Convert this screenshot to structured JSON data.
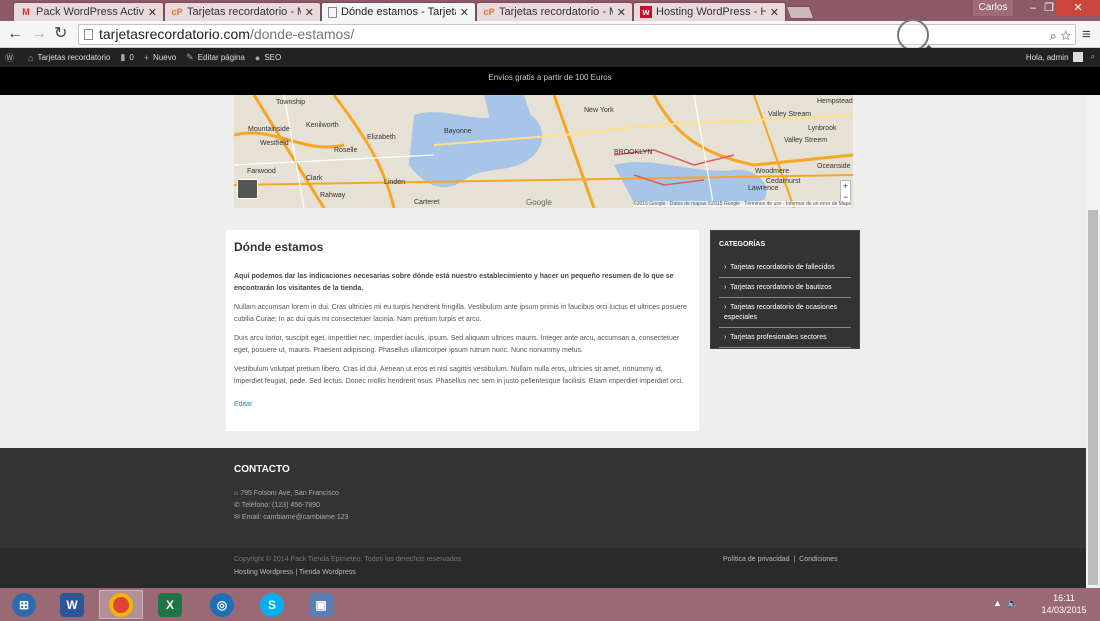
{
  "browser": {
    "tabs": [
      {
        "title": "Pack WordPress Activado",
        "icon": "gmail-icon"
      },
      {
        "title": "Tarjetas recordatorio - Mi",
        "icon": "cpanel-icon"
      },
      {
        "title": "Dónde estamos - Tarjetas",
        "icon": "page-icon",
        "active": true
      },
      {
        "title": "Tarjetas recordatorio - Mi",
        "icon": "cpanel-icon"
      },
      {
        "title": "Hosting WordPress - Host",
        "icon": "hosting-icon"
      }
    ],
    "user": "Carlos",
    "url_domain": "tarjetasrecordatorio.com",
    "url_path": "/donde-estamos/"
  },
  "adminbar": {
    "site": "Tarjetas recordatorio",
    "comments": "0",
    "new": "Nuevo",
    "edit": "Editar página",
    "seo": "SEO",
    "greeting": "Hola, admin"
  },
  "promo": "Envíos gratis a partir de 100 Euros",
  "map": {
    "labels": [
      "Township",
      "Mountainside",
      "Westfield",
      "Fanwood",
      "Clark",
      "Rahway",
      "Kenilworth",
      "Elizabeth",
      "Roselle",
      "Bayonne",
      "Linden",
      "Carteret",
      "BROOKLYN",
      "New York",
      "Valley Stream",
      "Woodmere",
      "Cedarhurst",
      "Lawrence",
      "Oceanside",
      "Lynbrook",
      "Hempstead",
      "Valley Streem"
    ],
    "google": "Google",
    "attribution": "©2015 Google · Datos de mapas ©2015 Google · Términos de uso · Informar de un error de Maps"
  },
  "main": {
    "title": "Dónde estamos",
    "lead": "Aquí podemos dar las indicaciones necesarias sobre dónde está nuestro establecimiento y hacer un pequeño resumen de lo que se encontrarán los visitantes de la tienda.",
    "p1": "Nullam accumsan lorem in dui. Cras ultricies mi eu turpis hendrerit fringilla. Vestibulum ante ipsum primis in faucibus orci luctus et ultrices posuere cubilia Curae; In ac dui quis mi consectetuer lacinia. Nam pretium turpis et arcu.",
    "p2": "Duis arcu tortor, suscipit eget, imperdiet nec, imperdiet iaculis, ipsum. Sed aliquam ultrices mauris. Integer ante arcu, accumsan a, consectetuer eget, posuere ut, mauris. Praesent adipiscing. Phasellus ullamcorper ipsum rutrum nunc. Nunc nonummy metus.",
    "p3": "Vestibulum volutpat pretium libero. Cras id dui. Aenean ut eros et nisl sagittis vestibulum. Nullam nulla eros, ultricies sit amet, nonummy id, imperdiet feugiat, pede. Sed lectus. Donec mollis hendrerit risus. Phasellus nec sem in justo pellentesque facilisis. Etiam imperdiet imperdiet orci.",
    "edit": "Editar"
  },
  "sidebar": {
    "title": "CATEGORÍAS",
    "items": [
      "Tarjetas recordatorio de fallecidos",
      "Tarjetas recordatorio de bautizos",
      "Tarjetas recordatorio de ocasiones especiales",
      "Tarjetas profesionales sectores"
    ]
  },
  "footer": {
    "title": "CONTACTO",
    "address": "795 Folsom Ave, San Francisco",
    "phone": "Teléfono: (123) 456-7890",
    "email": "Email: cambiame@cambiame.123",
    "copyright": "Copyright © 2014 Pack Tienda Epimeteo. Todos los derechos reservados.",
    "links": "Hosting Wordpress | Tienda Wordpress",
    "privacy": "Política de privacidad",
    "conditions": "Condiciones"
  },
  "taskbar": {
    "time": "16:11",
    "date": "14/03/2015"
  }
}
